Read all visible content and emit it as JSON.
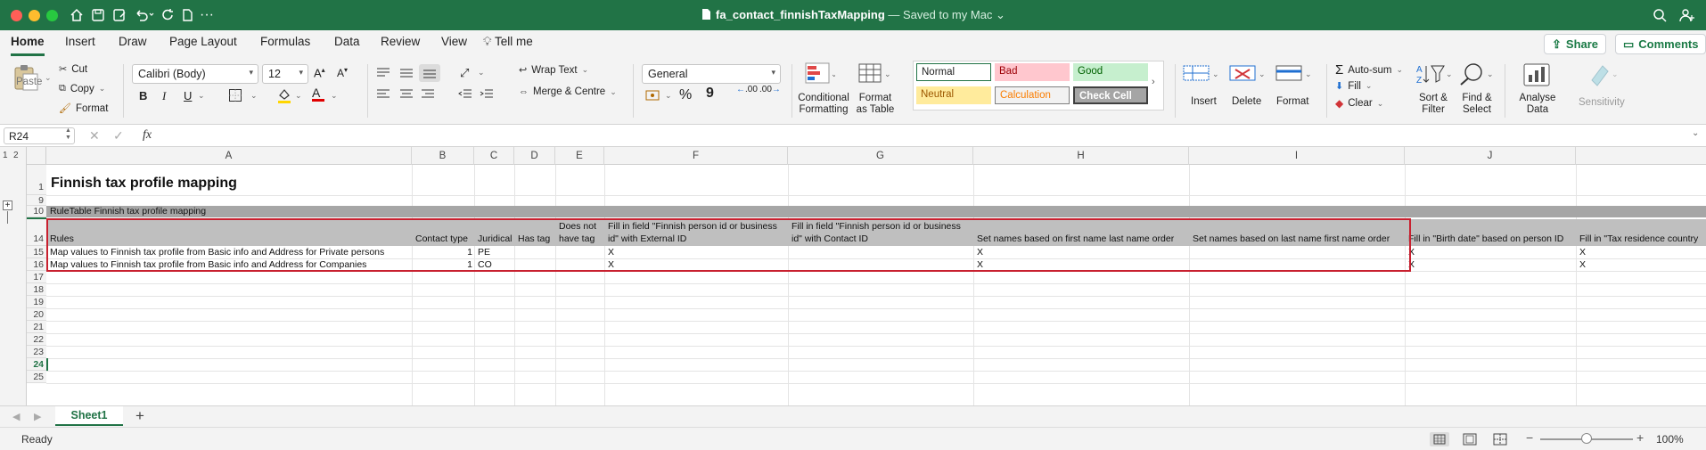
{
  "titlebar": {
    "filename": "fa_contact_finnishTaxMapping",
    "status": " — Saved to my Mac",
    "colors": {
      "bar": "#217346"
    }
  },
  "tabs": {
    "items": [
      "Home",
      "Insert",
      "Draw",
      "Page Layout",
      "Formulas",
      "Data",
      "Review",
      "View"
    ],
    "tell_me": "Tell me",
    "share_label": "Share",
    "comments_label": "Comments"
  },
  "ribbon": {
    "paste": "Paste",
    "cut": "Cut",
    "copy": "Copy",
    "format": "Format",
    "font_name": "Calibri (Body)",
    "font_size": "12",
    "bold": "B",
    "italic": "I",
    "underline": "U",
    "wrap_text": "Wrap Text",
    "merge_center": "Merge & Centre",
    "number_format": "General",
    "percent": "%",
    "comma": "9",
    "dec_inc": ".00",
    "dec_dec": ".00",
    "cond_fmt": [
      "Conditional",
      "Formatting"
    ],
    "fmt_table": [
      "Format",
      "as Table"
    ],
    "styles": {
      "normal": "Normal",
      "bad": "Bad",
      "good": "Good",
      "neutral": "Neutral",
      "calculation": "Calculation",
      "check_cell": "Check Cell"
    },
    "insert": "Insert",
    "delete": "Delete",
    "format_cells": "Format",
    "autosum": "Auto-sum",
    "fill": "Fill",
    "clear": "Clear",
    "sort_filter": [
      "Sort &",
      "Filter"
    ],
    "find_select": [
      "Find &",
      "Select"
    ],
    "analyse": [
      "Analyse",
      "Data"
    ],
    "sensitivity": "Sensitivity"
  },
  "formula_bar": {
    "name_box": "R24",
    "fx": "fx",
    "value": ""
  },
  "grid": {
    "outline_levels": [
      "1",
      "2"
    ],
    "columns": [
      "A",
      "B",
      "C",
      "D",
      "E",
      "F",
      "G",
      "H",
      "I",
      "J"
    ],
    "row_numbers": [
      "1",
      "9",
      "10",
      "14",
      "15",
      "16",
      "17",
      "18",
      "19",
      "20",
      "21",
      "22",
      "23",
      "24",
      "25"
    ],
    "title": "Finnish tax profile mapping",
    "rule_table_label": "RuleTable Finnish tax profile mapping",
    "header_row1": {
      "E": "Does not",
      "F": "Fill in field \"Finnish person id or business",
      "G": "Fill in field \"Finnish person id or business"
    },
    "header_row2": {
      "A": "Rules",
      "B": "Contact type",
      "C": "Juridical",
      "D": "Has tag",
      "E": "have tag",
      "F": "id\" with External ID",
      "G": "id\" with Contact ID",
      "H": "Set names based on first name last name order",
      "I": "Set names based on last name first name order",
      "J": "Fill in \"Birth date\" based on person ID",
      "K": "Fill in \"Tax residence country"
    },
    "rows": [
      {
        "A": "Map values to Finnish tax profile from Basic info and Address for Private persons",
        "B": "1",
        "C": "PE",
        "F": "X",
        "H": "X",
        "J": "X",
        "K": "X"
      },
      {
        "A": "Map values to Finnish tax profile from Basic info and Address for Companies",
        "B": "1",
        "C": "CO",
        "F": "X",
        "H": "X",
        "J": "X",
        "K": "X"
      }
    ],
    "highlight_color": "#c8202f"
  },
  "sheets": {
    "tabs": [
      "Sheet1"
    ],
    "add": "+"
  },
  "status": {
    "ready": "Ready",
    "zoom": "100%",
    "zoom_minus": "−",
    "zoom_plus": "+"
  }
}
